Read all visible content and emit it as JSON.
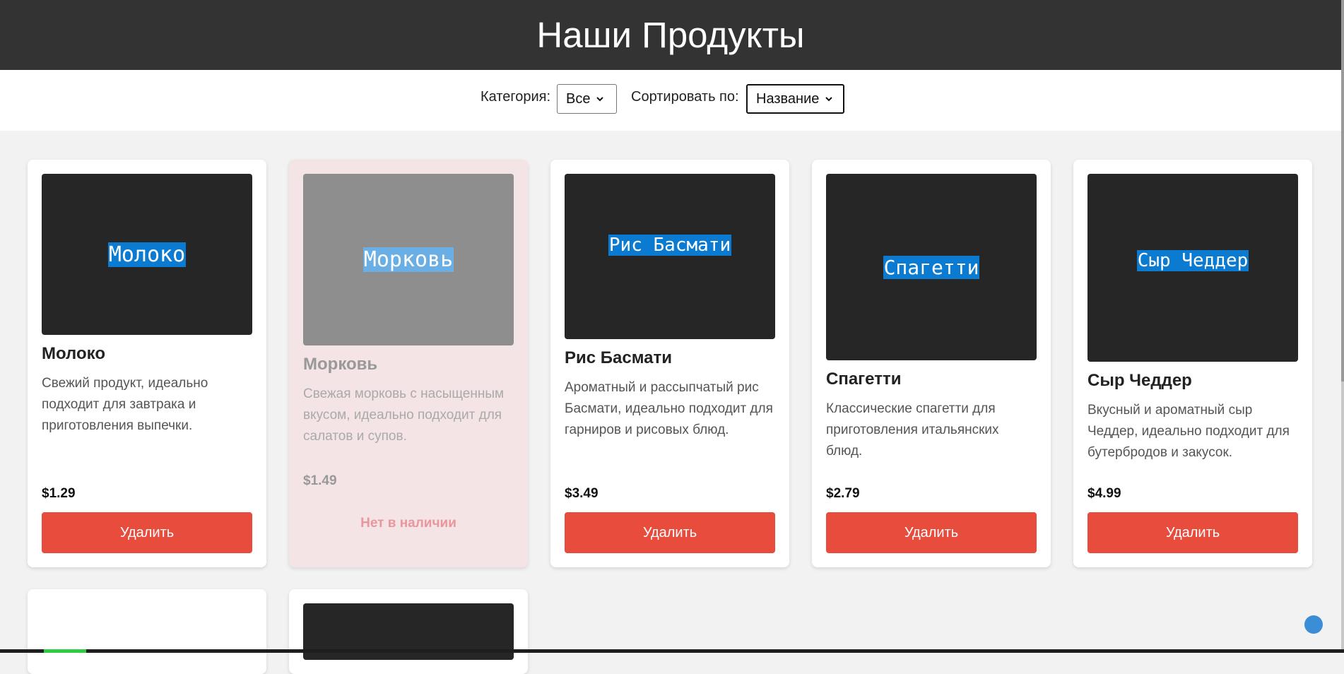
{
  "header": {
    "title": "Наши Продукты"
  },
  "filters": {
    "category_label": "Категория:",
    "category_value": "Все",
    "sort_label": "Сортировать по:",
    "sort_value": "Название"
  },
  "products": [
    {
      "image_label": "Молоко",
      "name": "Молоко",
      "description": "Свежий продукт, идеально подходит для завтрака и приготовления выпечки.",
      "price": "$1.29",
      "action_label": "Удалить"
    },
    {
      "image_label": "Морковь",
      "name": "Морковь",
      "description": "Свежая морковь с насыщенным вкусом, идеально подходит для салатов и супов.",
      "price": "$1.49",
      "status_label": "Нет в наличии"
    },
    {
      "image_label": "Рис Басмати",
      "name": "Рис Басмати",
      "description": "Ароматный и рассыпчатый рис Басмати, идеально подходит для гарниров и рисовых блюд.",
      "price": "$3.49",
      "action_label": "Удалить"
    },
    {
      "image_label": "Спагетти",
      "name": "Спагетти",
      "description": "Классические спагетти для приготовления итальянских блюд.",
      "price": "$2.79",
      "action_label": "Удалить"
    },
    {
      "image_label": "Сыр Чеддер",
      "name": "Сыр Чеддер",
      "description": "Вкусный и ароматный сыр Чеддер, идеально подходит для бутербродов и закусок.",
      "price": "$4.99",
      "action_label": "Удалить"
    }
  ],
  "colors": {
    "header_bg": "#333333",
    "delete_button": "#e74c3c",
    "out_of_stock_bg": "#f4e4e6",
    "image_label_highlight": "#0b7ad1"
  },
  "icons": {
    "select_arrow": "chevron-down-icon"
  }
}
